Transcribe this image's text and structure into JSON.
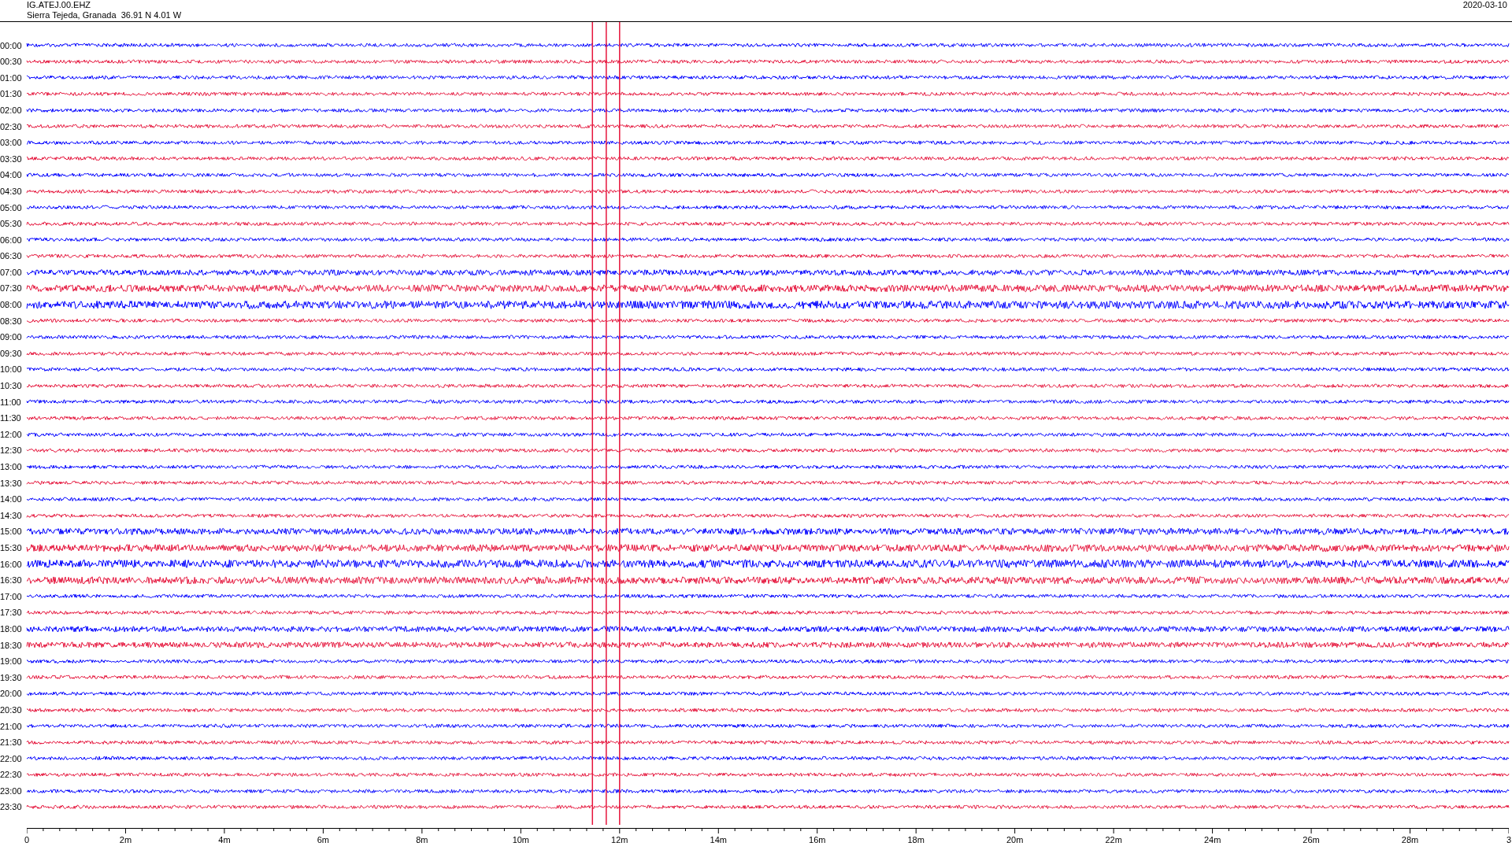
{
  "header": {
    "station": "IG.ATEJ.00.EHZ",
    "location": "Sierra Tejeda, Granada  36.91 N 4.01 W",
    "date": "2020-03-10"
  },
  "traces": [
    {
      "time": "00:00",
      "color": "#0000ff"
    },
    {
      "time": "00:30",
      "color": "#e6153c"
    },
    {
      "time": "01:00",
      "color": "#0000ff"
    },
    {
      "time": "01:30",
      "color": "#e6153c"
    },
    {
      "time": "02:00",
      "color": "#0000ff"
    },
    {
      "time": "02:30",
      "color": "#e6153c"
    },
    {
      "time": "03:00",
      "color": "#0000ff"
    },
    {
      "time": "03:30",
      "color": "#e6153c"
    },
    {
      "time": "04:00",
      "color": "#0000ff"
    },
    {
      "time": "04:30",
      "color": "#e6153c"
    },
    {
      "time": "05:00",
      "color": "#0000ff"
    },
    {
      "time": "05:30",
      "color": "#e6153c"
    },
    {
      "time": "06:00",
      "color": "#0000ff"
    },
    {
      "time": "06:30",
      "color": "#e6153c"
    },
    {
      "time": "07:00",
      "color": "#0000ff"
    },
    {
      "time": "07:30",
      "color": "#e6153c"
    },
    {
      "time": "08:00",
      "color": "#0000ff"
    },
    {
      "time": "08:30",
      "color": "#e6153c"
    },
    {
      "time": "09:00",
      "color": "#0000ff"
    },
    {
      "time": "09:30",
      "color": "#e6153c"
    },
    {
      "time": "10:00",
      "color": "#0000ff"
    },
    {
      "time": "10:30",
      "color": "#e6153c"
    },
    {
      "time": "11:00",
      "color": "#0000ff"
    },
    {
      "time": "11:30",
      "color": "#e6153c"
    },
    {
      "time": "12:00",
      "color": "#0000ff"
    },
    {
      "time": "12:30",
      "color": "#e6153c"
    },
    {
      "time": "13:00",
      "color": "#0000ff"
    },
    {
      "time": "13:30",
      "color": "#e6153c"
    },
    {
      "time": "14:00",
      "color": "#0000ff"
    },
    {
      "time": "14:30",
      "color": "#e6153c"
    },
    {
      "time": "15:00",
      "color": "#0000ff"
    },
    {
      "time": "15:30",
      "color": "#e6153c"
    },
    {
      "time": "16:00",
      "color": "#0000ff"
    },
    {
      "time": "16:30",
      "color": "#e6153c"
    },
    {
      "time": "17:00",
      "color": "#0000ff"
    },
    {
      "time": "17:30",
      "color": "#e6153c"
    },
    {
      "time": "18:00",
      "color": "#0000ff"
    },
    {
      "time": "18:30",
      "color": "#e6153c"
    },
    {
      "time": "19:00",
      "color": "#0000ff"
    },
    {
      "time": "19:30",
      "color": "#e6153c"
    },
    {
      "time": "20:00",
      "color": "#0000ff"
    },
    {
      "time": "20:30",
      "color": "#e6153c"
    },
    {
      "time": "21:00",
      "color": "#0000ff"
    },
    {
      "time": "21:30",
      "color": "#e6153c"
    },
    {
      "time": "22:00",
      "color": "#0000ff"
    },
    {
      "time": "22:30",
      "color": "#e6153c"
    },
    {
      "time": "23:00",
      "color": "#0000ff"
    },
    {
      "time": "23:30",
      "color": "#e6153c"
    }
  ],
  "axis": {
    "labels": [
      "0",
      "2m",
      "4m",
      "6m",
      "8m",
      "10m",
      "12m",
      "14m",
      "16m",
      "18m",
      "20m",
      "22m",
      "24m",
      "26m",
      "28m",
      "3"
    ]
  }
}
